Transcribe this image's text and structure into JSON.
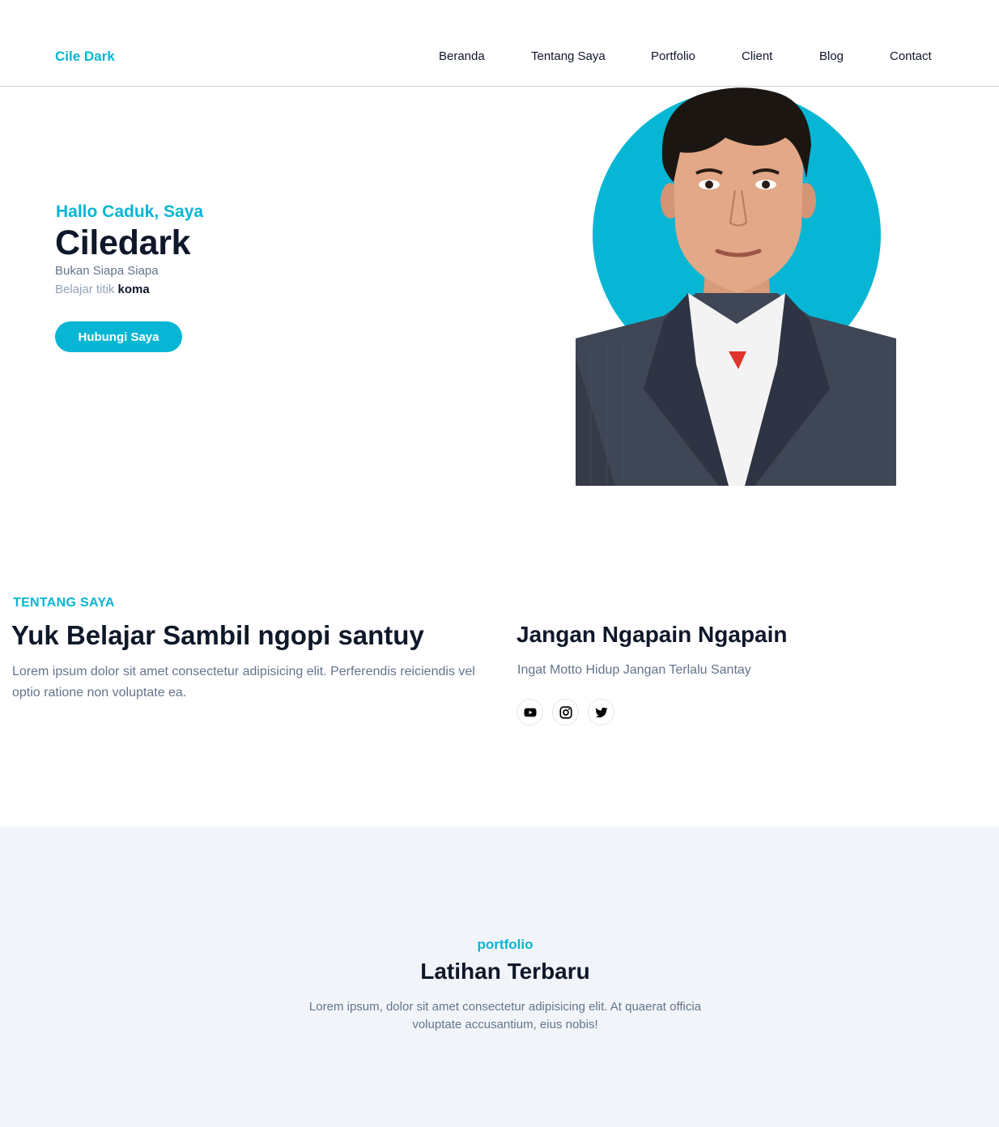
{
  "header": {
    "logo": "Cile Dark",
    "nav": [
      "Beranda",
      "Tentang Saya",
      "Portfolio",
      "Client",
      "Blog",
      "Contact"
    ]
  },
  "hero": {
    "greeting": "Hallo Caduk, Saya",
    "name": "Ciledark",
    "subtitle": "Bukan Siapa Siapa",
    "tagline_prefix": "Belajar titik",
    "tagline_bold": "koma",
    "button": "Hubungi Saya"
  },
  "about": {
    "label": "TENTANG SAYA",
    "title": "Yuk Belajar Sambil ngopi santuy",
    "text": "Lorem ipsum dolor sit amet consectetur adipisicing elit. Perferendis reiciendis vel optio ratione non voluptate ea.",
    "motto_title": "Jangan Ngapain Ngapain",
    "motto_text": "Ingat Motto Hidup Jangan Terlalu Santay",
    "social_icons": [
      "youtube-icon",
      "instagram-icon",
      "twitter-icon"
    ]
  },
  "portfolio": {
    "label": "portfolio",
    "title": "Latihan Terbaru",
    "text": "Lorem ipsum, dolor sit amet consectetur adipisicing elit. At quaerat officia voluptate accusantium, eius nobis!"
  },
  "colors": {
    "accent": "#06b6d4",
    "dark": "#0f172a",
    "muted": "#64748b",
    "section_bg": "#f1f5f9"
  }
}
